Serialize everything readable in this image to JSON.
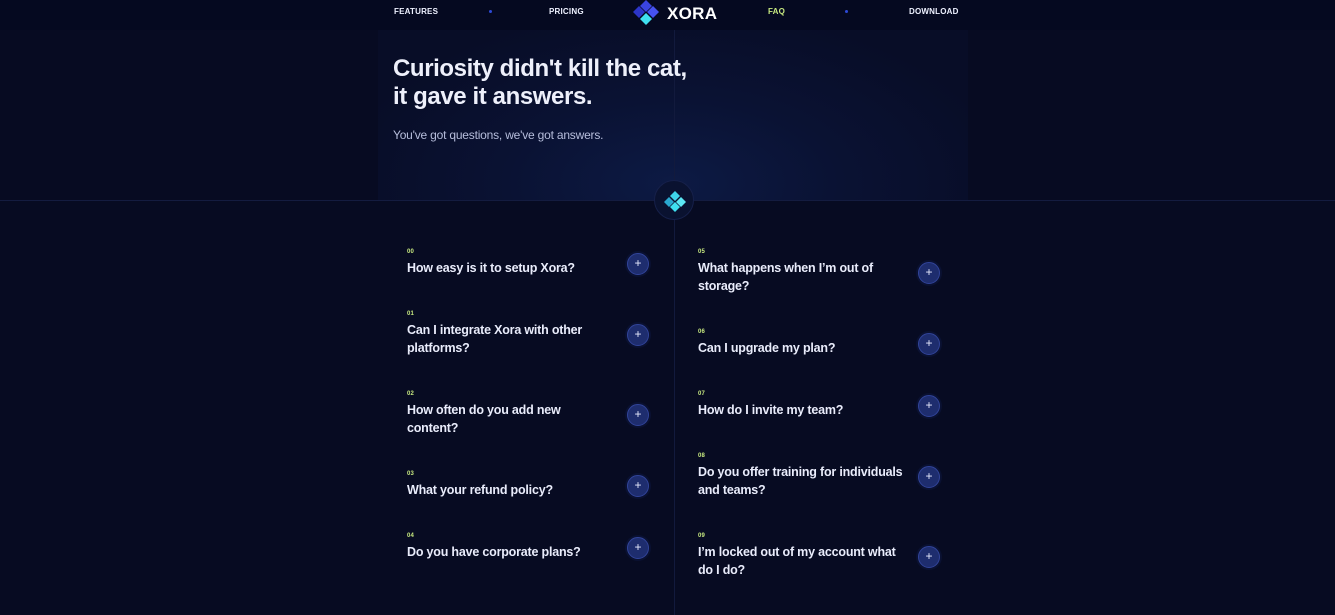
{
  "nav": {
    "features": "FEATURES",
    "pricing": "PRICING",
    "logo": "XORA",
    "faq": "FAQ",
    "download": "DOWNLOAD"
  },
  "hero": {
    "title_line1": "Curiosity didn't kill the cat,",
    "title_line2": "it gave it answers.",
    "subtitle": "You've got questions, we've got answers."
  },
  "colors": {
    "background": "#070b22",
    "accent_green": "#c8ea80",
    "logo_blue": "#2f3bd9",
    "logo_cyan": "#3fe0f0",
    "button_blue": "#1e2d6e"
  },
  "faq": {
    "left": [
      {
        "num": "00",
        "question": "How easy is it to setup Xora?"
      },
      {
        "num": "01",
        "question": "Can I integrate Xora with other platforms?"
      },
      {
        "num": "02",
        "question": "How often do you add new content?"
      },
      {
        "num": "03",
        "question": "What your refund policy?"
      },
      {
        "num": "04",
        "question": "Do you have corporate plans?"
      }
    ],
    "right": [
      {
        "num": "05",
        "question": "What happens when I’m out of storage?"
      },
      {
        "num": "06",
        "question": "Can I upgrade my plan?"
      },
      {
        "num": "07",
        "question": "How do I invite my team?"
      },
      {
        "num": "08",
        "question": "Do you offer training for individuals and teams?"
      },
      {
        "num": "09",
        "question": "I’m locked out of my account what do I do?"
      }
    ],
    "expand_symbol": "+"
  }
}
